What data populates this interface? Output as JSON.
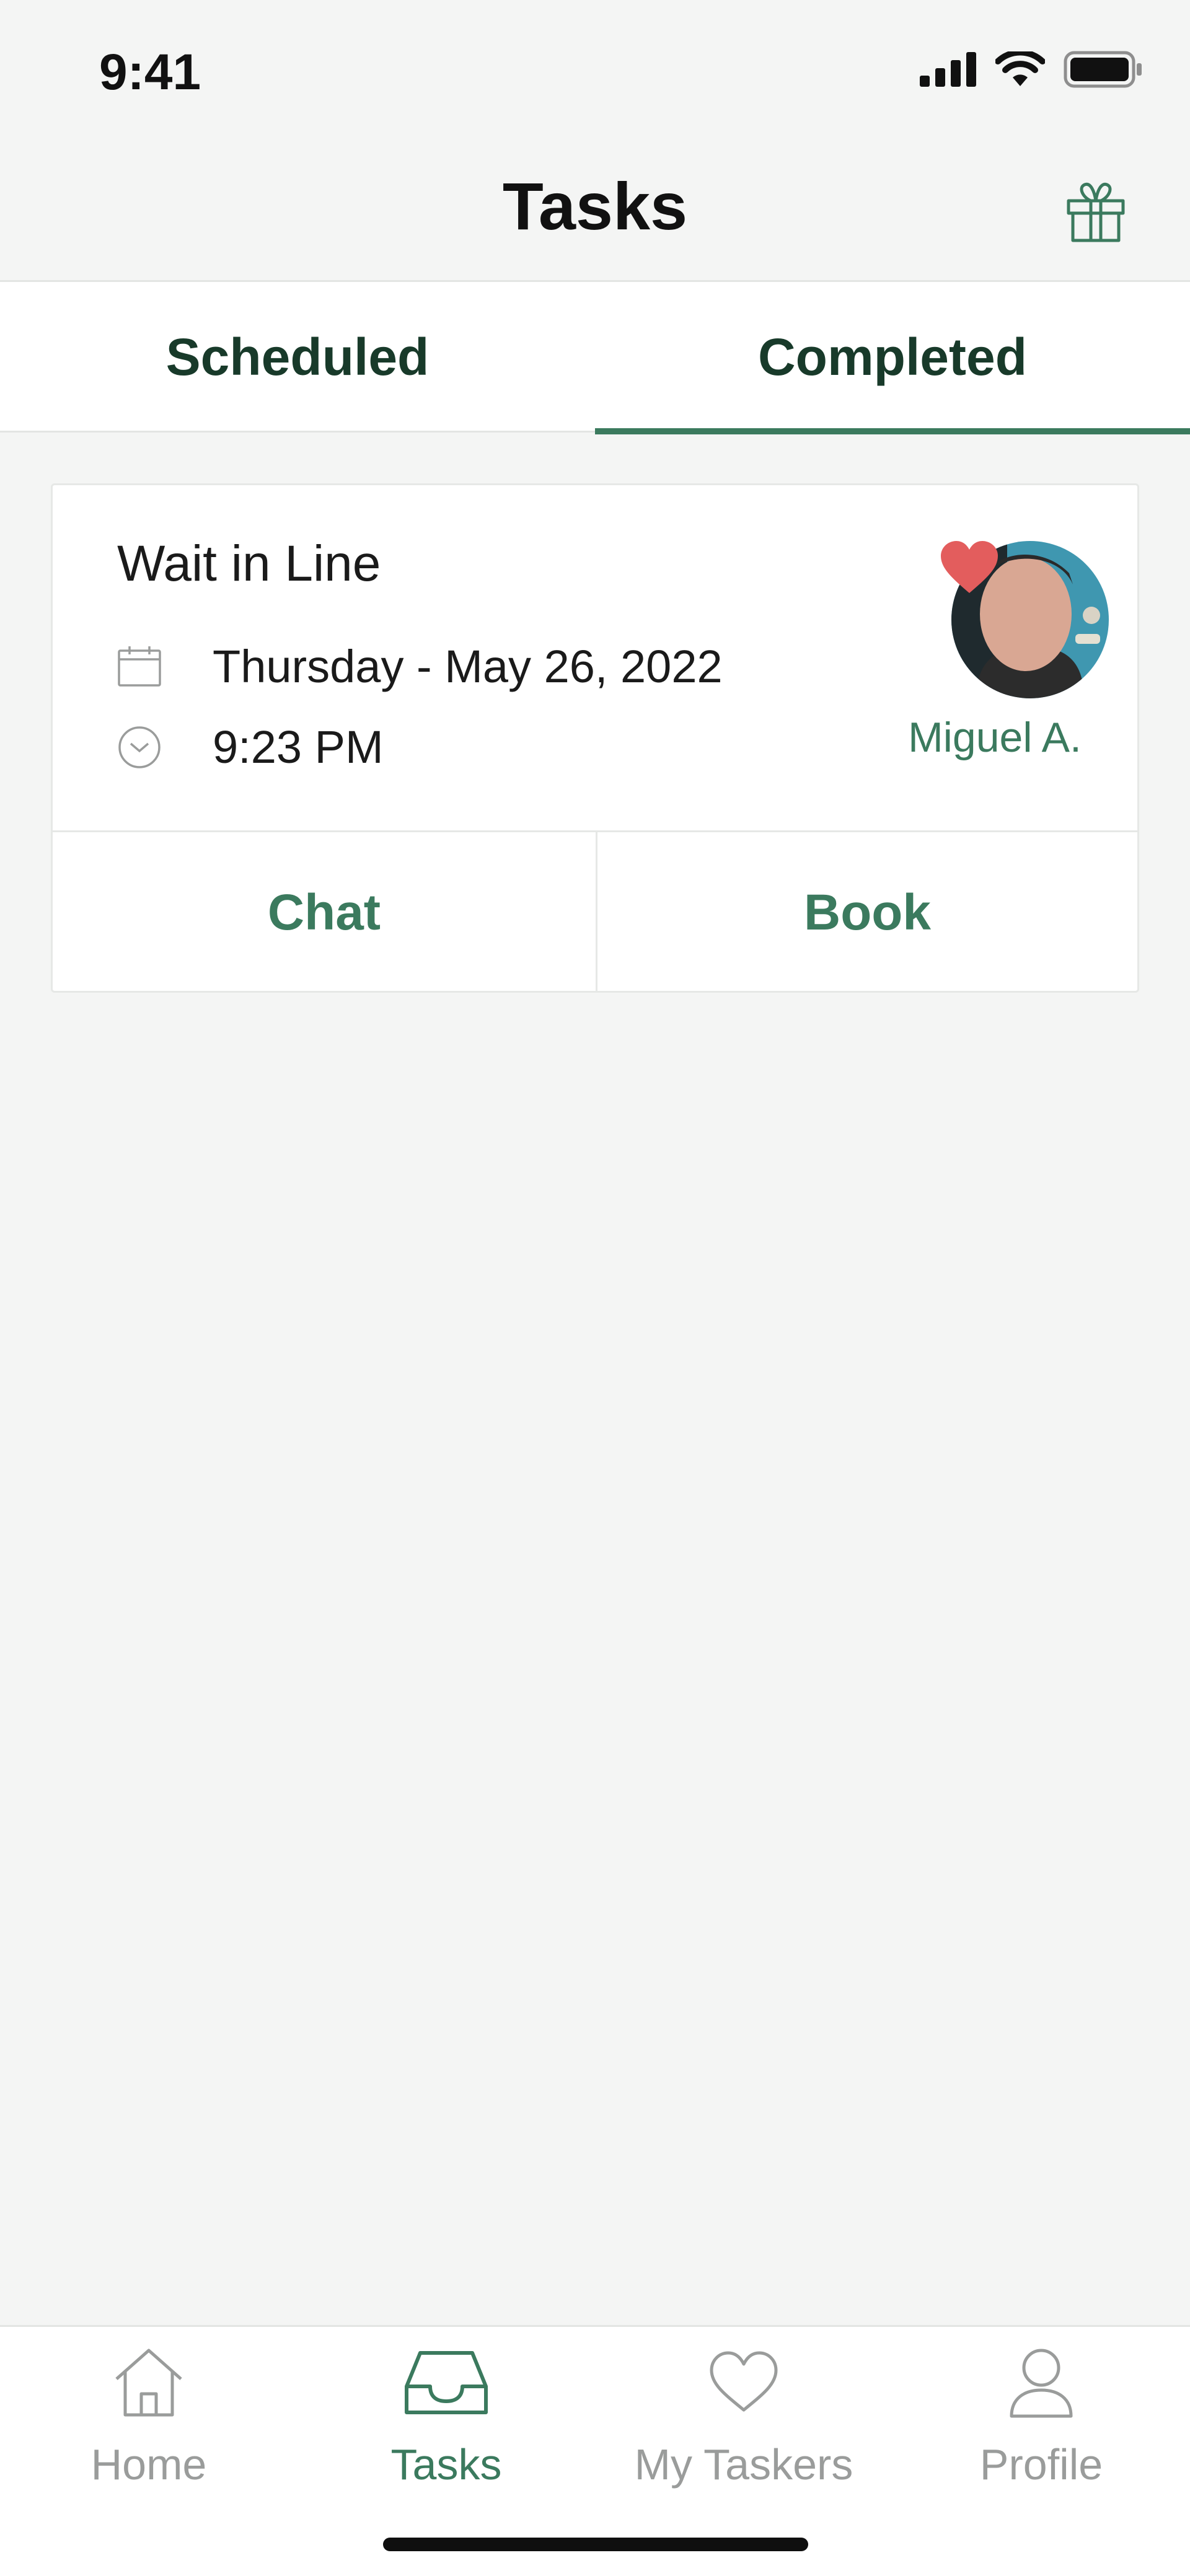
{
  "status_bar": {
    "time": "9:41",
    "icons": [
      "signal-icon",
      "wifi-icon",
      "battery-icon"
    ]
  },
  "header": {
    "title": "Tasks",
    "gift_icon": "gift-icon"
  },
  "tabs": [
    {
      "label": "Scheduled",
      "active": false
    },
    {
      "label": "Completed",
      "active": true
    }
  ],
  "task_card": {
    "title": "Wait in Line",
    "date": "Thursday - May 26, 2022",
    "time": "9:23 PM",
    "tasker_name": "Miguel A.",
    "favorite": true,
    "actions": {
      "chat": "Chat",
      "book": "Book"
    }
  },
  "bottom_nav": [
    {
      "label": "Home",
      "icon": "home-icon",
      "active": false
    },
    {
      "label": "Tasks",
      "icon": "inbox-icon",
      "active": true
    },
    {
      "label": "My Taskers",
      "icon": "heart-icon",
      "active": false
    },
    {
      "label": "Profile",
      "icon": "person-icon",
      "active": false
    }
  ],
  "colors": {
    "accent": "#3b7a5e",
    "background": "#f4f5f4",
    "heart": "#e35d5d",
    "inactive": "#9a9c9b"
  }
}
